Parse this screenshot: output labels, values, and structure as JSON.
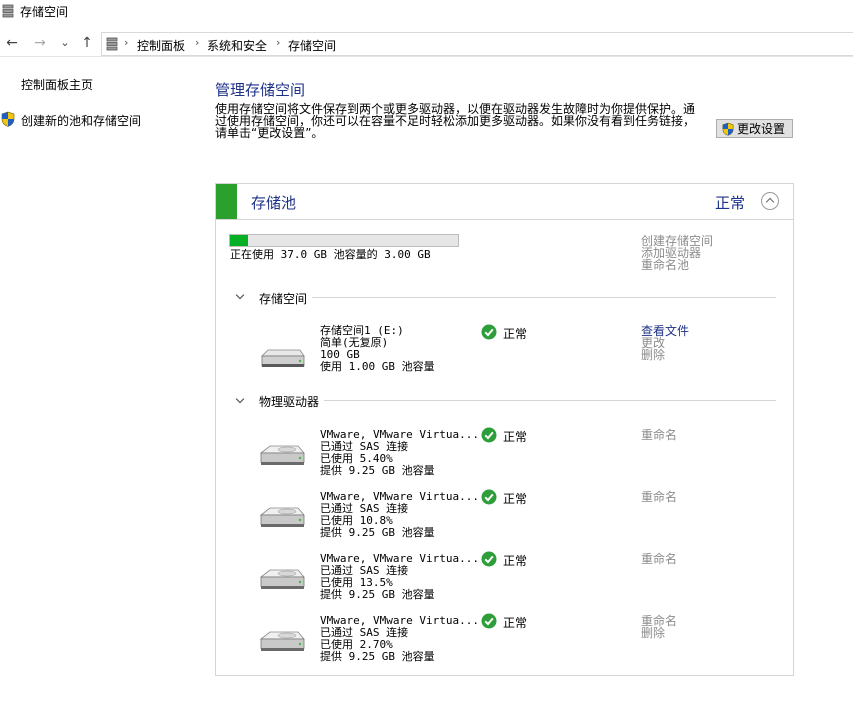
{
  "window": {
    "title": "存储空间",
    "icon": "storage-spaces-icon"
  },
  "nav": {
    "back": "←",
    "forward": "→",
    "recent": "⌄",
    "up": "↑",
    "breadcrumb": [
      "控制面板",
      "系统和安全",
      "存储空间"
    ],
    "sep": "›"
  },
  "sidebar": {
    "home": "控制面板主页",
    "create_pool": "创建新的池和存储空间"
  },
  "main": {
    "title": "管理存储空间",
    "description": "使用存储空间将文件保存到两个或更多驱动器，以便在驱动器发生故障时为你提供保护。通过使用存储空间，你还可以在容量不足时轻松添加更多驱动器。如果你没有看到任务链接，请单击“更改设置”。",
    "change_settings": "更改设置"
  },
  "pool": {
    "title": "存储池",
    "status": "正常",
    "usage_text": "正在使用 37.0 GB 池容量的 3.00 GB",
    "usage_fraction": 0.08,
    "actions": [
      "创建存储空间",
      "添加驱动器",
      "重命名池"
    ]
  },
  "spaces_section": {
    "title": "存储空间",
    "items": [
      {
        "name": "存储空间1 (E:)",
        "resiliency": "简单(无复原)",
        "size": "100 GB",
        "used": "使用 1.00 GB 池容量",
        "status": "正常",
        "actions": [
          "查看文件",
          "更改",
          "删除"
        ]
      }
    ]
  },
  "drives_section": {
    "title": "物理驱动器",
    "items": [
      {
        "name": "VMware, VMware Virtua...",
        "conn": "已通过 SAS 连接",
        "used": "已使用 5.40%",
        "provide": "提供 9.25 GB 池容量",
        "status": "正常",
        "actions": [
          "重命名"
        ]
      },
      {
        "name": "VMware, VMware Virtua...",
        "conn": "已通过 SAS 连接",
        "used": "已使用 10.8%",
        "provide": "提供 9.25 GB 池容量",
        "status": "正常",
        "actions": [
          "重命名"
        ]
      },
      {
        "name": "VMware, VMware Virtua...",
        "conn": "已通过 SAS 连接",
        "used": "已使用 13.5%",
        "provide": "提供 9.25 GB 池容量",
        "status": "正常",
        "actions": [
          "重命名"
        ]
      },
      {
        "name": "VMware, VMware Virtua...",
        "conn": "已通过 SAS 连接",
        "used": "已使用 2.70%",
        "provide": "提供 9.25 GB 池容量",
        "status": "正常",
        "actions": [
          "重命名",
          "删除"
        ]
      }
    ]
  },
  "colors": {
    "accent": "#1e3287",
    "pool_bar": "#2ca02c",
    "ok": "#2e9e3a",
    "usage_fill": "#06b025"
  }
}
